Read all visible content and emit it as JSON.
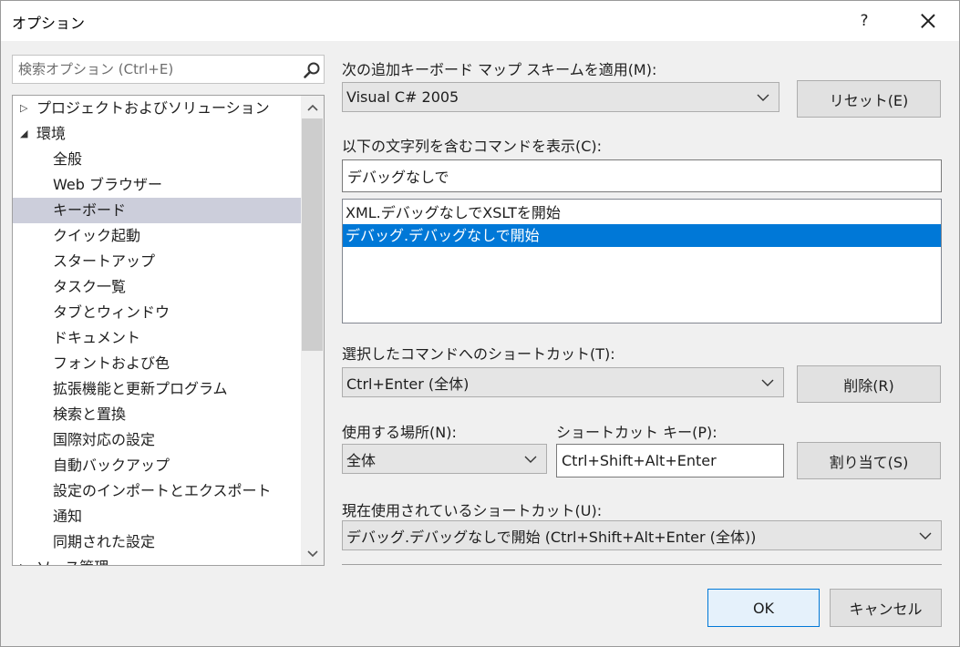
{
  "window": {
    "title": "オプション",
    "help": "?"
  },
  "search": {
    "placeholder": "検索オプション (Ctrl+E)"
  },
  "tree": {
    "items": [
      {
        "label": "プロジェクトおよびソリューション",
        "arrow": "▷"
      },
      {
        "label": "環境",
        "arrow": "◢"
      },
      {
        "label": "全般"
      },
      {
        "label": "Web ブラウザー"
      },
      {
        "label": "キーボード"
      },
      {
        "label": "クイック起動"
      },
      {
        "label": "スタートアップ"
      },
      {
        "label": "タスク一覧"
      },
      {
        "label": "タブとウィンドウ"
      },
      {
        "label": "ドキュメント"
      },
      {
        "label": "フォントおよび色"
      },
      {
        "label": "拡張機能と更新プログラム"
      },
      {
        "label": "検索と置換"
      },
      {
        "label": "国際対応の設定"
      },
      {
        "label": "自動バックアップ"
      },
      {
        "label": "設定のインポートとエクスポート"
      },
      {
        "label": "通知"
      },
      {
        "label": "同期された設定"
      },
      {
        "label": "ソース管理",
        "arrow": "▷"
      }
    ]
  },
  "mapping": {
    "label": "次の追加キーボード マップ スキームを適用(M):",
    "value": "Visual C# 2005",
    "reset_button": "リセット(E)"
  },
  "filter": {
    "label": "以下の文字列を含むコマンドを表示(C):",
    "value": "デバッグなしで"
  },
  "commands": {
    "items": [
      "XML.デバッグなしでXSLTを開始",
      "デバッグ.デバッグなしで開始"
    ]
  },
  "shortcut_for_selected": {
    "label": "選択したコマンドへのショートカット(T):",
    "value": "Ctrl+Enter (全体)",
    "remove_button": "削除(R)"
  },
  "scope": {
    "label": "使用する場所(N):",
    "value": "全体"
  },
  "shortcut_key": {
    "label": "ショートカット キー(P):",
    "value": "Ctrl+Shift+Alt+Enter",
    "assign_button": "割り当て(S)"
  },
  "current_usage": {
    "label": "現在使用されているショートカット(U):",
    "value": "デバッグ.デバッグなしで開始 (Ctrl+Shift+Alt+Enter (全体))"
  },
  "footer": {
    "ok": "OK",
    "cancel": "キャンセル"
  },
  "colors": {
    "selection_blue": "#0078d7",
    "tree_selection": "#cccedb",
    "window_bg": "#f0f0f0"
  }
}
